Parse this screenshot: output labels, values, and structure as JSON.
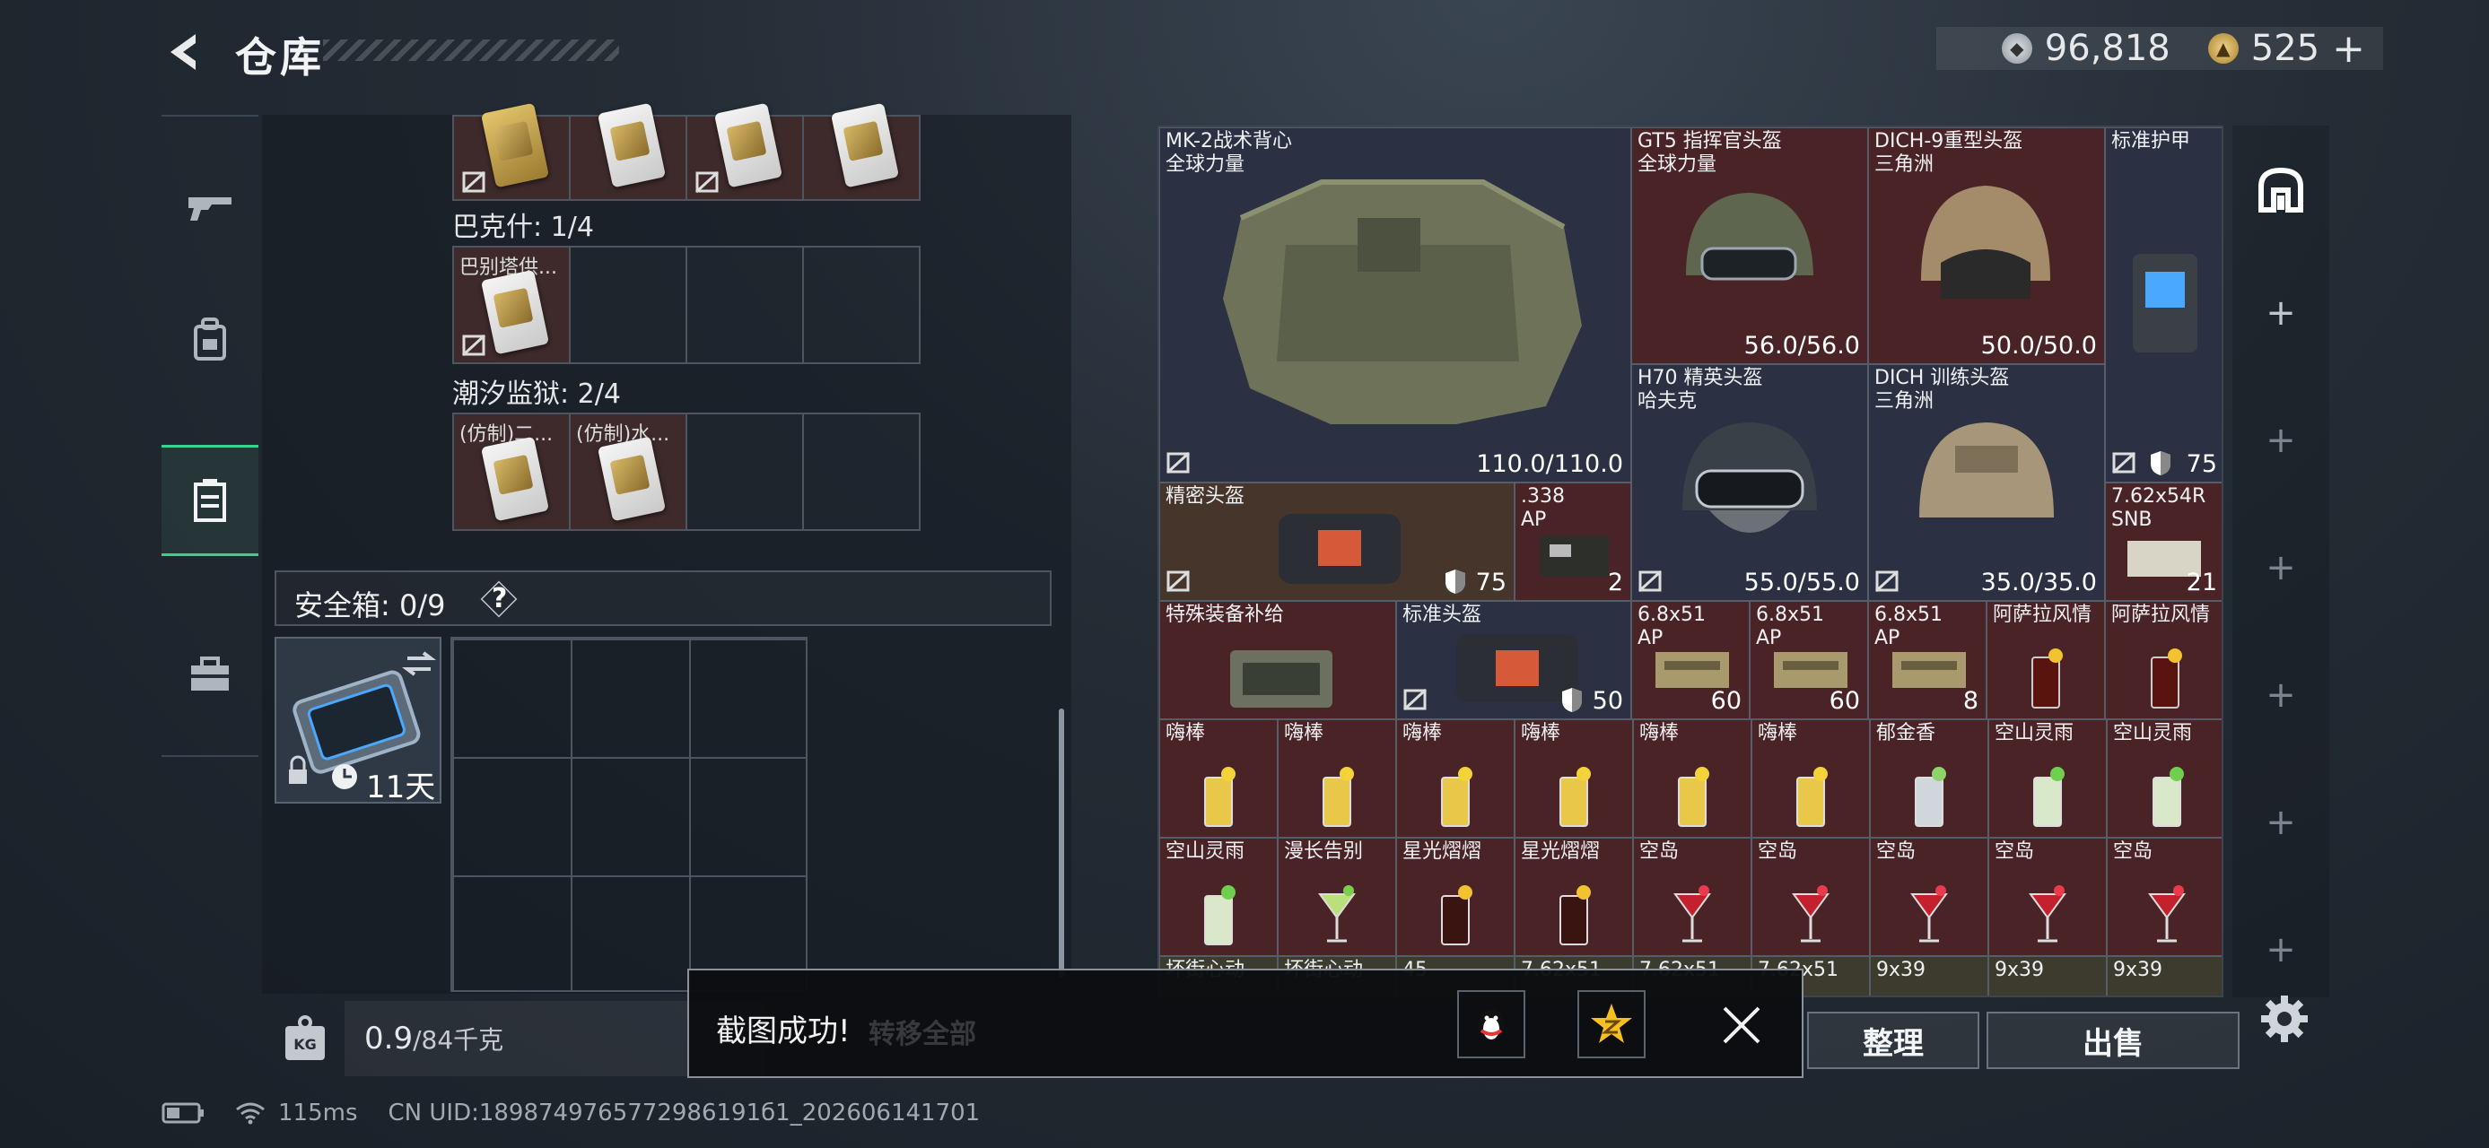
{
  "header": {
    "title": "仓库"
  },
  "currency": {
    "primary": "96,818",
    "secondary": "525",
    "add": "+"
  },
  "left": {
    "section1": {
      "label": "巴克什: 1/4",
      "item_caption": "巴别塔供..."
    },
    "section2": {
      "label": "潮汐监狱: 2/4",
      "items": [
        "(仿制)二...",
        "(仿制)水..."
      ]
    },
    "safebox": {
      "label": "安全箱: 0/9",
      "help": "?",
      "timer": "11天"
    },
    "weight": {
      "value": "0.9",
      "capacity": "/84千克"
    }
  },
  "inventory": {
    "vest": {
      "name": "MK-2战术背心\n全球力量",
      "durability": "110.0/110.0"
    },
    "helmet1": {
      "name": "GT5 指挥官头盔\n全球力量",
      "durability": "56.0/56.0"
    },
    "helmet2": {
      "name": "DICH-9重型头盔\n三角洲",
      "durability": "50.0/50.0"
    },
    "armor_std": {
      "name": "标准护甲",
      "level": "75"
    },
    "helmet3": {
      "name": "H70 精英头盔\n哈夫克",
      "durability": "55.0/55.0"
    },
    "helmet4": {
      "name": "DICH 训练头盔\n三角洲",
      "durability": "35.0/35.0"
    },
    "precision_helmet": {
      "name": "精密头盔",
      "level": "75"
    },
    "ammo_338": {
      "name": ".338\nAP",
      "count": "2"
    },
    "ammo_762": {
      "name": "7.62x54R\nSNB",
      "count": "21"
    },
    "supply": {
      "name": "特殊装备补给"
    },
    "std_helmet": {
      "name": "标准头盔",
      "level": "50"
    },
    "ammo_68_1": {
      "name": "6.8x51\nAP",
      "count": "60"
    },
    "ammo_68_2": {
      "name": "6.8x51\nAP",
      "count": "60"
    },
    "ammo_68_3": {
      "name": "6.8x51\nAP",
      "count": "8"
    },
    "drink_asl1": {
      "name": "阿萨拉风情"
    },
    "drink_asl2": {
      "name": "阿萨拉风情"
    },
    "row5": [
      "嗨棒",
      "嗨棒",
      "嗨棒",
      "嗨棒",
      "嗨棒",
      "嗨棒",
      "郁金香",
      "空山灵雨",
      "空山灵雨"
    ],
    "row6": [
      "空山灵雨",
      "漫长告别",
      "星光熠熠",
      "星光熠熠",
      "空岛",
      "空岛",
      "空岛",
      "空岛",
      "空岛"
    ],
    "row7": [
      "坏街心动",
      "坏街心动",
      "45",
      "7.62x51",
      "7.62x51",
      "7.62x51",
      "9x39",
      "9x39",
      "9x39"
    ]
  },
  "buttons": {
    "sort": "整理",
    "sell": "出售",
    "behind_toast": "转移全部"
  },
  "toast": {
    "text": "截图成功!"
  },
  "status": {
    "ping": "115ms",
    "uid": "CN UID:1898749765772986191б1_202606141701"
  },
  "colors": {
    "accent": "#3ecf8e",
    "item_red": "#4a2327",
    "item_blue": "#2b3142"
  }
}
